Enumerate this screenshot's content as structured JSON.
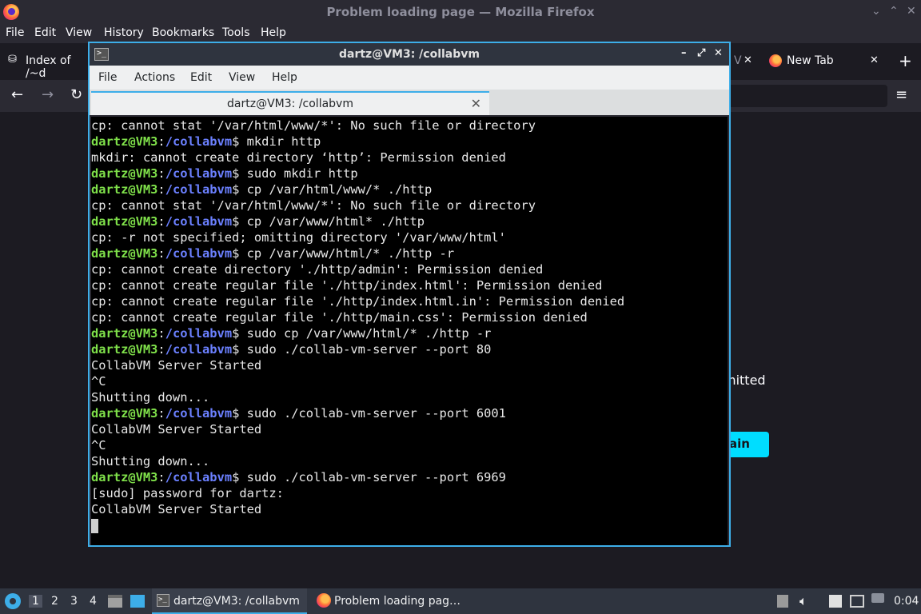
{
  "firefox": {
    "window_title": "Problem loading page — Mozilla Firefox",
    "window_controls": {
      "minimize": "⌄",
      "maximize": "⌃",
      "close": "✕"
    },
    "menu": [
      "File",
      "Edit",
      "View",
      "History",
      "Bookmarks",
      "Tools",
      "Help"
    ],
    "tabs": [
      {
        "label": "Index of /~d",
        "icon": "page-icon"
      },
      {
        "label": "New Tab",
        "icon": "firefox-icon",
        "close": "✕"
      }
    ],
    "new_tab": "+",
    "hidden_tab_fragment": "V",
    "hidden_tab_close": "✕",
    "list_all_tabs": "≡",
    "nav": {
      "back": "←",
      "forward": "→",
      "reload": "↻",
      "bookmark": "☆",
      "menu": "≡"
    },
    "content": {
      "permitted_fragment": "mitted",
      "try_again_fragment": "ain"
    }
  },
  "terminal": {
    "window_title": "dartz@VM3: /collabvm",
    "icon_glyph": ">_",
    "controls": {
      "minimize": "–",
      "restore": "⤢",
      "close": "✕"
    },
    "menu": [
      "File",
      "Actions",
      "Edit",
      "View",
      "Help"
    ],
    "tab": {
      "label": "dartz@VM3: /collabvm",
      "close": "✕"
    },
    "lines": [
      {
        "text": "cp: cannot stat '/var/html/www/*': No such file or directory"
      },
      {
        "prompt": true,
        "user": "dartz@VM3",
        "path": "/collabvm",
        "cmd": " mkdir http"
      },
      {
        "text": "mkdir: cannot create directory ‘http’: Permission denied"
      },
      {
        "prompt": true,
        "user": "dartz@VM3",
        "path": "/collabvm",
        "cmd": " sudo mkdir http"
      },
      {
        "prompt": true,
        "user": "dartz@VM3",
        "path": "/collabvm",
        "cmd": " cp /var/html/www/* ./http"
      },
      {
        "text": "cp: cannot stat '/var/html/www/*': No such file or directory"
      },
      {
        "prompt": true,
        "user": "dartz@VM3",
        "path": "/collabvm",
        "cmd": " cp /var/www/html* ./http"
      },
      {
        "text": "cp: -r not specified; omitting directory '/var/www/html'"
      },
      {
        "prompt": true,
        "user": "dartz@VM3",
        "path": "/collabvm",
        "cmd": " cp /var/www/html/* ./http -r"
      },
      {
        "text": "cp: cannot create directory './http/admin': Permission denied"
      },
      {
        "text": "cp: cannot create regular file './http/index.html': Permission denied"
      },
      {
        "text": "cp: cannot create regular file './http/index.html.in': Permission denied"
      },
      {
        "text": "cp: cannot create regular file './http/main.css': Permission denied"
      },
      {
        "prompt": true,
        "user": "dartz@VM3",
        "path": "/collabvm",
        "cmd": " sudo cp /var/www/html/* ./http -r"
      },
      {
        "prompt": true,
        "user": "dartz@VM3",
        "path": "/collabvm",
        "cmd": " sudo ./collab-vm-server --port 80"
      },
      {
        "text": "CollabVM Server Started"
      },
      {
        "text": "^C"
      },
      {
        "text": "Shutting down..."
      },
      {
        "prompt": true,
        "user": "dartz@VM3",
        "path": "/collabvm",
        "cmd": " sudo ./collab-vm-server --port 6001"
      },
      {
        "text": "CollabVM Server Started"
      },
      {
        "text": "^C"
      },
      {
        "text": "Shutting down..."
      },
      {
        "prompt": true,
        "user": "dartz@VM3",
        "path": "/collabvm",
        "cmd": " sudo ./collab-vm-server --port 6969"
      },
      {
        "text": "[sudo] password for dartz:"
      },
      {
        "text": "CollabVM Server Started"
      }
    ],
    "colors": {
      "user": "#7fe04a",
      "path": "#6b80ff",
      "text": "#e8e8e8",
      "background": "#000000"
    }
  },
  "taskbar": {
    "desktops": [
      "1",
      "2",
      "3",
      "4"
    ],
    "tasks": [
      {
        "label": "dartz@VM3: /collabvm",
        "icon": "terminal-icon",
        "active": true
      },
      {
        "label": "Problem loading pag…",
        "icon": "firefox-icon",
        "active": false
      }
    ],
    "clock": "0:04"
  }
}
